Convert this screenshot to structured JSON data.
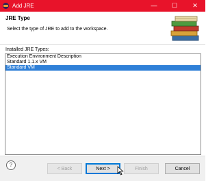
{
  "window": {
    "title": "Add JRE",
    "minimize_glyph": "—",
    "maximize_glyph": "☐",
    "close_glyph": "✕"
  },
  "header": {
    "page_title": "JRE Type",
    "description": "Select the type of JRE to add to the workspace.",
    "banner_icon": "books-icon"
  },
  "list": {
    "label": "Installed JRE Types:",
    "items": [
      {
        "label": "Execution Environment Description",
        "selected": false
      },
      {
        "label": "Standard 1.1.x VM",
        "selected": false
      },
      {
        "label": "Standard VM",
        "selected": true
      }
    ]
  },
  "footer": {
    "help_glyph": "?",
    "back_label": "< Back",
    "next_label": "Next >",
    "finish_label": "Finish",
    "cancel_label": "Cancel"
  },
  "colors": {
    "titlebar": "#e8132a",
    "selection": "#2f80d8",
    "primary_button_border": "#0078d7"
  }
}
